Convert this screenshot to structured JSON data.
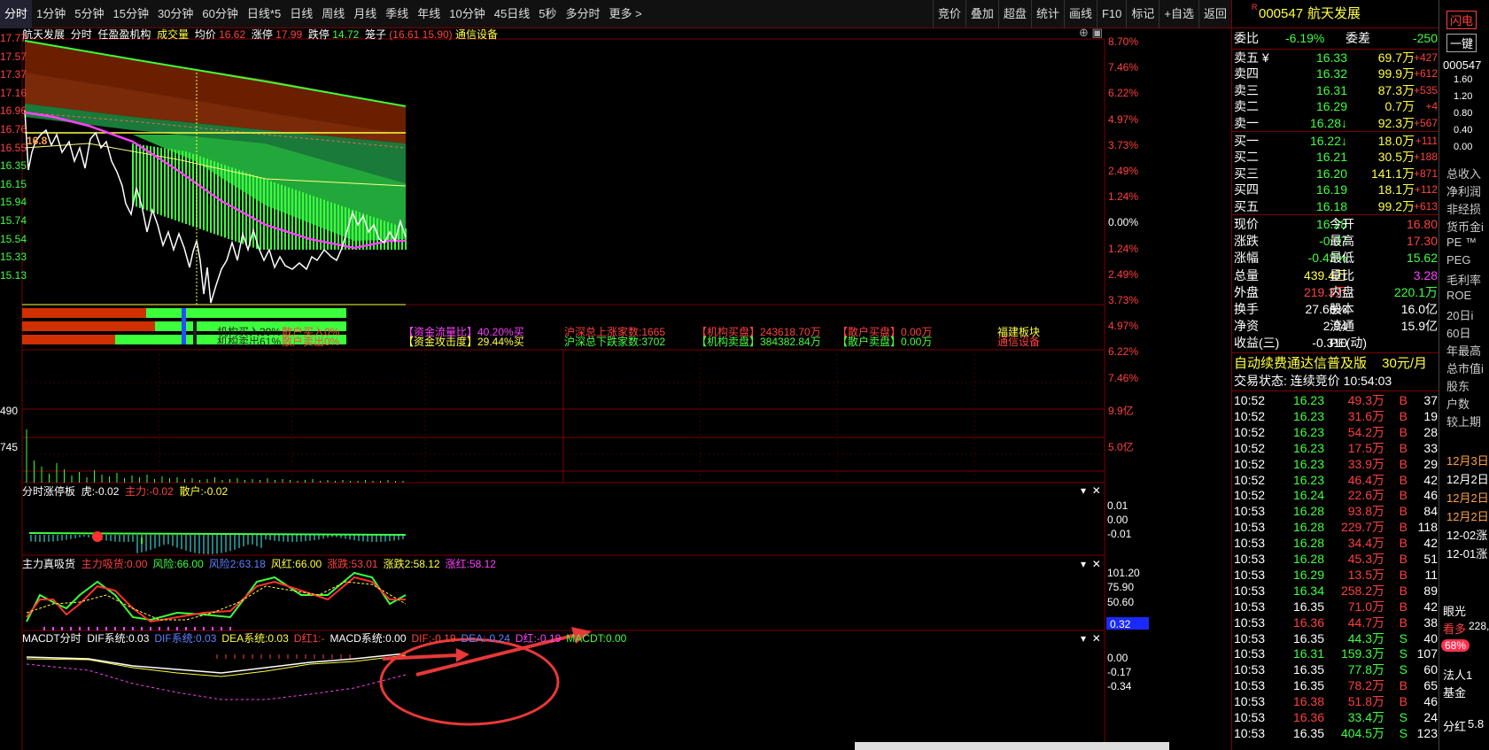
{
  "toolbar": {
    "tabs": [
      "分时",
      "1分钟",
      "5分钟",
      "15分钟",
      "30分钟",
      "60分钟",
      "日线*5",
      "日线",
      "周线",
      "月线",
      "季线",
      "年线",
      "10分钟",
      "45日线",
      "5秒",
      "多分时",
      "更多 >"
    ],
    "right_buttons": [
      "竞价",
      "叠加",
      "超盘",
      "统计",
      "画线",
      "F10",
      "标记",
      "+自选",
      "返回"
    ]
  },
  "chart_header": {
    "stock_name": "航天发展",
    "mode": "分时",
    "indicator": "任盈盈机构",
    "volume_label": "成交量",
    "avg_label": "均价",
    "avg_value": "16.62",
    "limit_up_label": "涨停",
    "limit_up_value": "17.99",
    "limit_down_label": "跌停",
    "limit_down_value": "14.72",
    "cage_label": "笼子",
    "cage_value": "(16.61 15.90)",
    "sector": "通信设备"
  },
  "price_axis_left": [
    "17.77",
    "17.57",
    "17.37",
    "17.16",
    "16.96",
    "16.76",
    "16.55",
    "16.35",
    "16.15",
    "15.94",
    "15.74",
    "15.54",
    "15.33",
    "15.13"
  ],
  "pct_axis_right": [
    "8.70%",
    "7.46%",
    "6.22%",
    "4.97%",
    "3.73%",
    "2.49%",
    "1.24%",
    "0.00%",
    "1.24%",
    "2.49%",
    "3.73%",
    "4.97%",
    "6.22%",
    "7.46%"
  ],
  "chart_marker": "16.8",
  "volume_axis_left": [
    "490",
    "745"
  ],
  "volume_axis_right": [
    "9.9亿",
    "5.0亿"
  ],
  "institution_panel": {
    "buy_label": "机构买入39%",
    "retail_buy_label": "散户买入0%",
    "sell_label": "机构卖出61%",
    "retail_sell_label": "散户卖出0%",
    "fund_inflow": "【资金流量比】40.20%买",
    "fund_attack": "【资金攻击度】29.44%买",
    "hs_up": "沪深总上涨家数:1665",
    "hs_down": "沪深总下跌家数:3702",
    "inst_buy": "【机构买盘】243618.70万",
    "inst_sell": "【机构卖盘】384382.84万",
    "retail_buy": "【散户买盘】0.00万",
    "retail_sell": "【散户卖盘】0.00万",
    "sector1": "福建板块",
    "sector2": "通信设备"
  },
  "subchart1": {
    "title": "分时涨停板",
    "tiger_label": "虎:",
    "tiger_value": "-0.02",
    "main_label": "主力:",
    "main_value": "-0.02",
    "retail_label": "散户:",
    "retail_value": "-0.02",
    "axis": [
      "0.01",
      "0.00",
      "-0.01"
    ]
  },
  "subchart2": {
    "title": "主力真吸货",
    "items": [
      {
        "label": "主力吸货:",
        "value": "0.00",
        "color": "#ff4040"
      },
      {
        "label": "风险:",
        "value": "66.00",
        "color": "#40ff40"
      },
      {
        "label": "风险2:",
        "value": "63.18",
        "color": "#6080ff"
      },
      {
        "label": "风红:",
        "value": "66.00",
        "color": "#ffff40"
      },
      {
        "label": "涨跌:",
        "value": "53.01",
        "color": "#ff4040"
      },
      {
        "label": "涨跌2:",
        "value": "58.12",
        "color": "#ffff40"
      },
      {
        "label": "涨红:",
        "value": "58.12",
        "color": "#ff40ff"
      }
    ],
    "axis": [
      "101.20",
      "75.90",
      "50.60"
    ]
  },
  "subchart3": {
    "title": "MACDT分时",
    "items": [
      {
        "label": "DIF系统:",
        "value": "0.03",
        "color": "#ffffff"
      },
      {
        "label": "DIF系统:",
        "value": "0.03",
        "color": "#6080ff"
      },
      {
        "label": "DEA系统:",
        "value": "0.03",
        "color": "#ffff40"
      },
      {
        "label": "D红1:",
        "value": "-",
        "color": "#ff4040"
      },
      {
        "label": "MACD系统:",
        "value": "0.00",
        "color": "#ffffff"
      },
      {
        "label": "DIF:",
        "value": "-0.19",
        "color": "#ff4040"
      },
      {
        "label": "DEA:",
        "value": "-0.24",
        "color": "#6080ff"
      },
      {
        "label": "D红:",
        "value": "-0.19",
        "color": "#ff40ff"
      },
      {
        "label": "MACDT:",
        "value": "0.00",
        "color": "#40ff40"
      }
    ],
    "axis": [
      "0.00",
      "-0.17",
      "-0.34"
    ],
    "cursor_value": "0.32"
  },
  "quote": {
    "code": "000547",
    "name": "航天发展",
    "wei_bi_label": "委比",
    "wei_bi": "-6.19%",
    "wei_cha_label": "委差",
    "wei_cha": "-250",
    "asks": [
      {
        "label": "卖五 ¥",
        "price": "16.33",
        "vol": "69.7万",
        "chg": "+427"
      },
      {
        "label": "卖四",
        "price": "16.32",
        "vol": "99.9万",
        "chg": "+612"
      },
      {
        "label": "卖三",
        "price": "16.31",
        "vol": "87.3万",
        "chg": "+535"
      },
      {
        "label": "卖二",
        "price": "16.29",
        "vol": "0.7万",
        "chg": "+4"
      },
      {
        "label": "卖一",
        "price": "16.28↓",
        "vol": "92.3万",
        "chg": "+567"
      }
    ],
    "bids": [
      {
        "label": "买一",
        "price": "16.22↓",
        "vol": "18.0万",
        "chg": "+111"
      },
      {
        "label": "买二",
        "price": "16.21",
        "vol": "30.5万",
        "chg": "+188"
      },
      {
        "label": "买三",
        "price": "16.20",
        "vol": "141.1万",
        "chg": "+871"
      },
      {
        "label": "买四",
        "price": "16.19",
        "vol": "18.1万",
        "chg": "+112"
      },
      {
        "label": "买五",
        "price": "16.18",
        "vol": "99.2万",
        "chg": "+613"
      }
    ],
    "stats": [
      {
        "l1": "现价",
        "v1": "16.28",
        "c1": "#40ff40",
        "l2": "今开",
        "v2": "16.80",
        "c2": "#ff4040"
      },
      {
        "l1": "涨跌",
        "v1": "-0.07",
        "c1": "#40ff40",
        "l2": "最高",
        "v2": "17.30",
        "c2": "#ff4040"
      },
      {
        "l1": "涨幅",
        "v1": "-0.43%",
        "c1": "#40ff40",
        "l2": "最低",
        "v2": "15.62",
        "c2": "#40ff40"
      },
      {
        "l1": "总量",
        "v1": "439.4万",
        "c1": "#ffff40",
        "l2": "量比",
        "v2": "3.28",
        "c2": "#ff40ff"
      },
      {
        "l1": "外盘",
        "v1": "219.3万",
        "c1": "#ff4040",
        "l2": "内盘",
        "v2": "220.1万",
        "c2": "#40ff40"
      },
      {
        "l1": "换手",
        "v1": "27.66%",
        "c1": "#ffffff",
        "l2": "股本",
        "v2": "16.0亿",
        "c2": "#ffffff"
      },
      {
        "l1": "净资",
        "v1": "2.94",
        "c1": "#ffffff",
        "l2": "流通",
        "v2": "15.9亿",
        "c2": "#ffffff"
      },
      {
        "l1": "收益(三)",
        "v1": "-0.310",
        "c1": "#ffffff",
        "l2": "PE(动)",
        "v2": "",
        "c2": "#ffffff"
      }
    ],
    "promo": "自动续费通达信普及版",
    "promo_price": "30元/月",
    "trade_status": "交易状态: 连续竞价 10:54:03",
    "ticks": [
      {
        "t": "10:52",
        "p": "16.23",
        "v": "49.3万",
        "bs": "B",
        "n": "37",
        "pc": "#40ff40",
        "vc": "#ff4040"
      },
      {
        "t": "10:52",
        "p": "16.23",
        "v": "31.6万",
        "bs": "B",
        "n": "19",
        "pc": "#40ff40",
        "vc": "#ff4040"
      },
      {
        "t": "10:52",
        "p": "16.23",
        "v": "54.2万",
        "bs": "B",
        "n": "28",
        "pc": "#40ff40",
        "vc": "#ff4040"
      },
      {
        "t": "10:52",
        "p": "16.23",
        "v": "17.5万",
        "bs": "B",
        "n": "33",
        "pc": "#40ff40",
        "vc": "#ff4040"
      },
      {
        "t": "10:52",
        "p": "16.23",
        "v": "33.9万",
        "bs": "B",
        "n": "29",
        "pc": "#40ff40",
        "vc": "#ff4040"
      },
      {
        "t": "10:52",
        "p": "16.23",
        "v": "46.4万",
        "bs": "B",
        "n": "42",
        "pc": "#40ff40",
        "vc": "#ff4040"
      },
      {
        "t": "10:52",
        "p": "16.24",
        "v": "22.6万",
        "bs": "B",
        "n": "46",
        "pc": "#40ff40",
        "vc": "#ff4040"
      },
      {
        "t": "10:53",
        "p": "16.28",
        "v": "93.8万",
        "bs": "B",
        "n": "84",
        "pc": "#40ff40",
        "vc": "#ff4040"
      },
      {
        "t": "10:53",
        "p": "16.28",
        "v": "229.7万",
        "bs": "B",
        "n": "118",
        "pc": "#40ff40",
        "vc": "#ff4040"
      },
      {
        "t": "10:53",
        "p": "16.28",
        "v": "34.4万",
        "bs": "B",
        "n": "42",
        "pc": "#40ff40",
        "vc": "#ff4040"
      },
      {
        "t": "10:53",
        "p": "16.28",
        "v": "45.3万",
        "bs": "B",
        "n": "51",
        "pc": "#40ff40",
        "vc": "#ff4040"
      },
      {
        "t": "10:53",
        "p": "16.29",
        "v": "13.5万",
        "bs": "B",
        "n": "11",
        "pc": "#40ff40",
        "vc": "#ff4040"
      },
      {
        "t": "10:53",
        "p": "16.34",
        "v": "258.2万",
        "bs": "B",
        "n": "89",
        "pc": "#40ff40",
        "vc": "#ff4040"
      },
      {
        "t": "10:53",
        "p": "16.35",
        "v": "71.0万",
        "bs": "B",
        "n": "42",
        "pc": "#ffffff",
        "vc": "#ff4040"
      },
      {
        "t": "10:53",
        "p": "16.36",
        "v": "44.7万",
        "bs": "B",
        "n": "38",
        "pc": "#ff4040",
        "vc": "#ff4040"
      },
      {
        "t": "10:53",
        "p": "16.35",
        "v": "44.3万",
        "bs": "S",
        "n": "40",
        "pc": "#ffffff",
        "vc": "#40ff40"
      },
      {
        "t": "10:53",
        "p": "16.31",
        "v": "159.3万",
        "bs": "S",
        "n": "107",
        "pc": "#40ff40",
        "vc": "#40ff40"
      },
      {
        "t": "10:53",
        "p": "16.35",
        "v": "77.8万",
        "bs": "S",
        "n": "60",
        "pc": "#ffffff",
        "vc": "#40ff40"
      },
      {
        "t": "10:53",
        "p": "16.35",
        "v": "78.2万",
        "bs": "B",
        "n": "65",
        "pc": "#ffffff",
        "vc": "#ff4040"
      },
      {
        "t": "10:53",
        "p": "16.38",
        "v": "51.8万",
        "bs": "B",
        "n": "46",
        "pc": "#ff4040",
        "vc": "#ff4040"
      },
      {
        "t": "10:53",
        "p": "16.36",
        "v": "33.4万",
        "bs": "S",
        "n": "24",
        "pc": "#ff4040",
        "vc": "#40ff40"
      },
      {
        "t": "10:53",
        "p": "16.35",
        "v": "404.5万",
        "bs": "S",
        "n": "123",
        "pc": "#ffffff",
        "vc": "#40ff40"
      }
    ]
  },
  "far_right": {
    "btn1": "闪电",
    "btn2": "一键",
    "code": "000547",
    "axis": [
      "1.60",
      "1.20",
      "0.80",
      "0.40",
      "0.00"
    ],
    "labels": [
      "总收入",
      "净利润",
      "非经损",
      "货币金i",
      "PE ™",
      "PEG",
      "毛利率",
      "ROE",
      "20日i",
      "60日",
      "年最高",
      "总市值i",
      "股东",
      "户数",
      "较上期"
    ],
    "dates": [
      "12月3日",
      "12月2日",
      "12月2日",
      "12月2日",
      "12-02涨",
      "12-01涨"
    ],
    "bottom": [
      "眼光",
      "看多",
      "228,",
      "68%",
      "法人1",
      "基金",
      "分红",
      "5.8"
    ]
  }
}
